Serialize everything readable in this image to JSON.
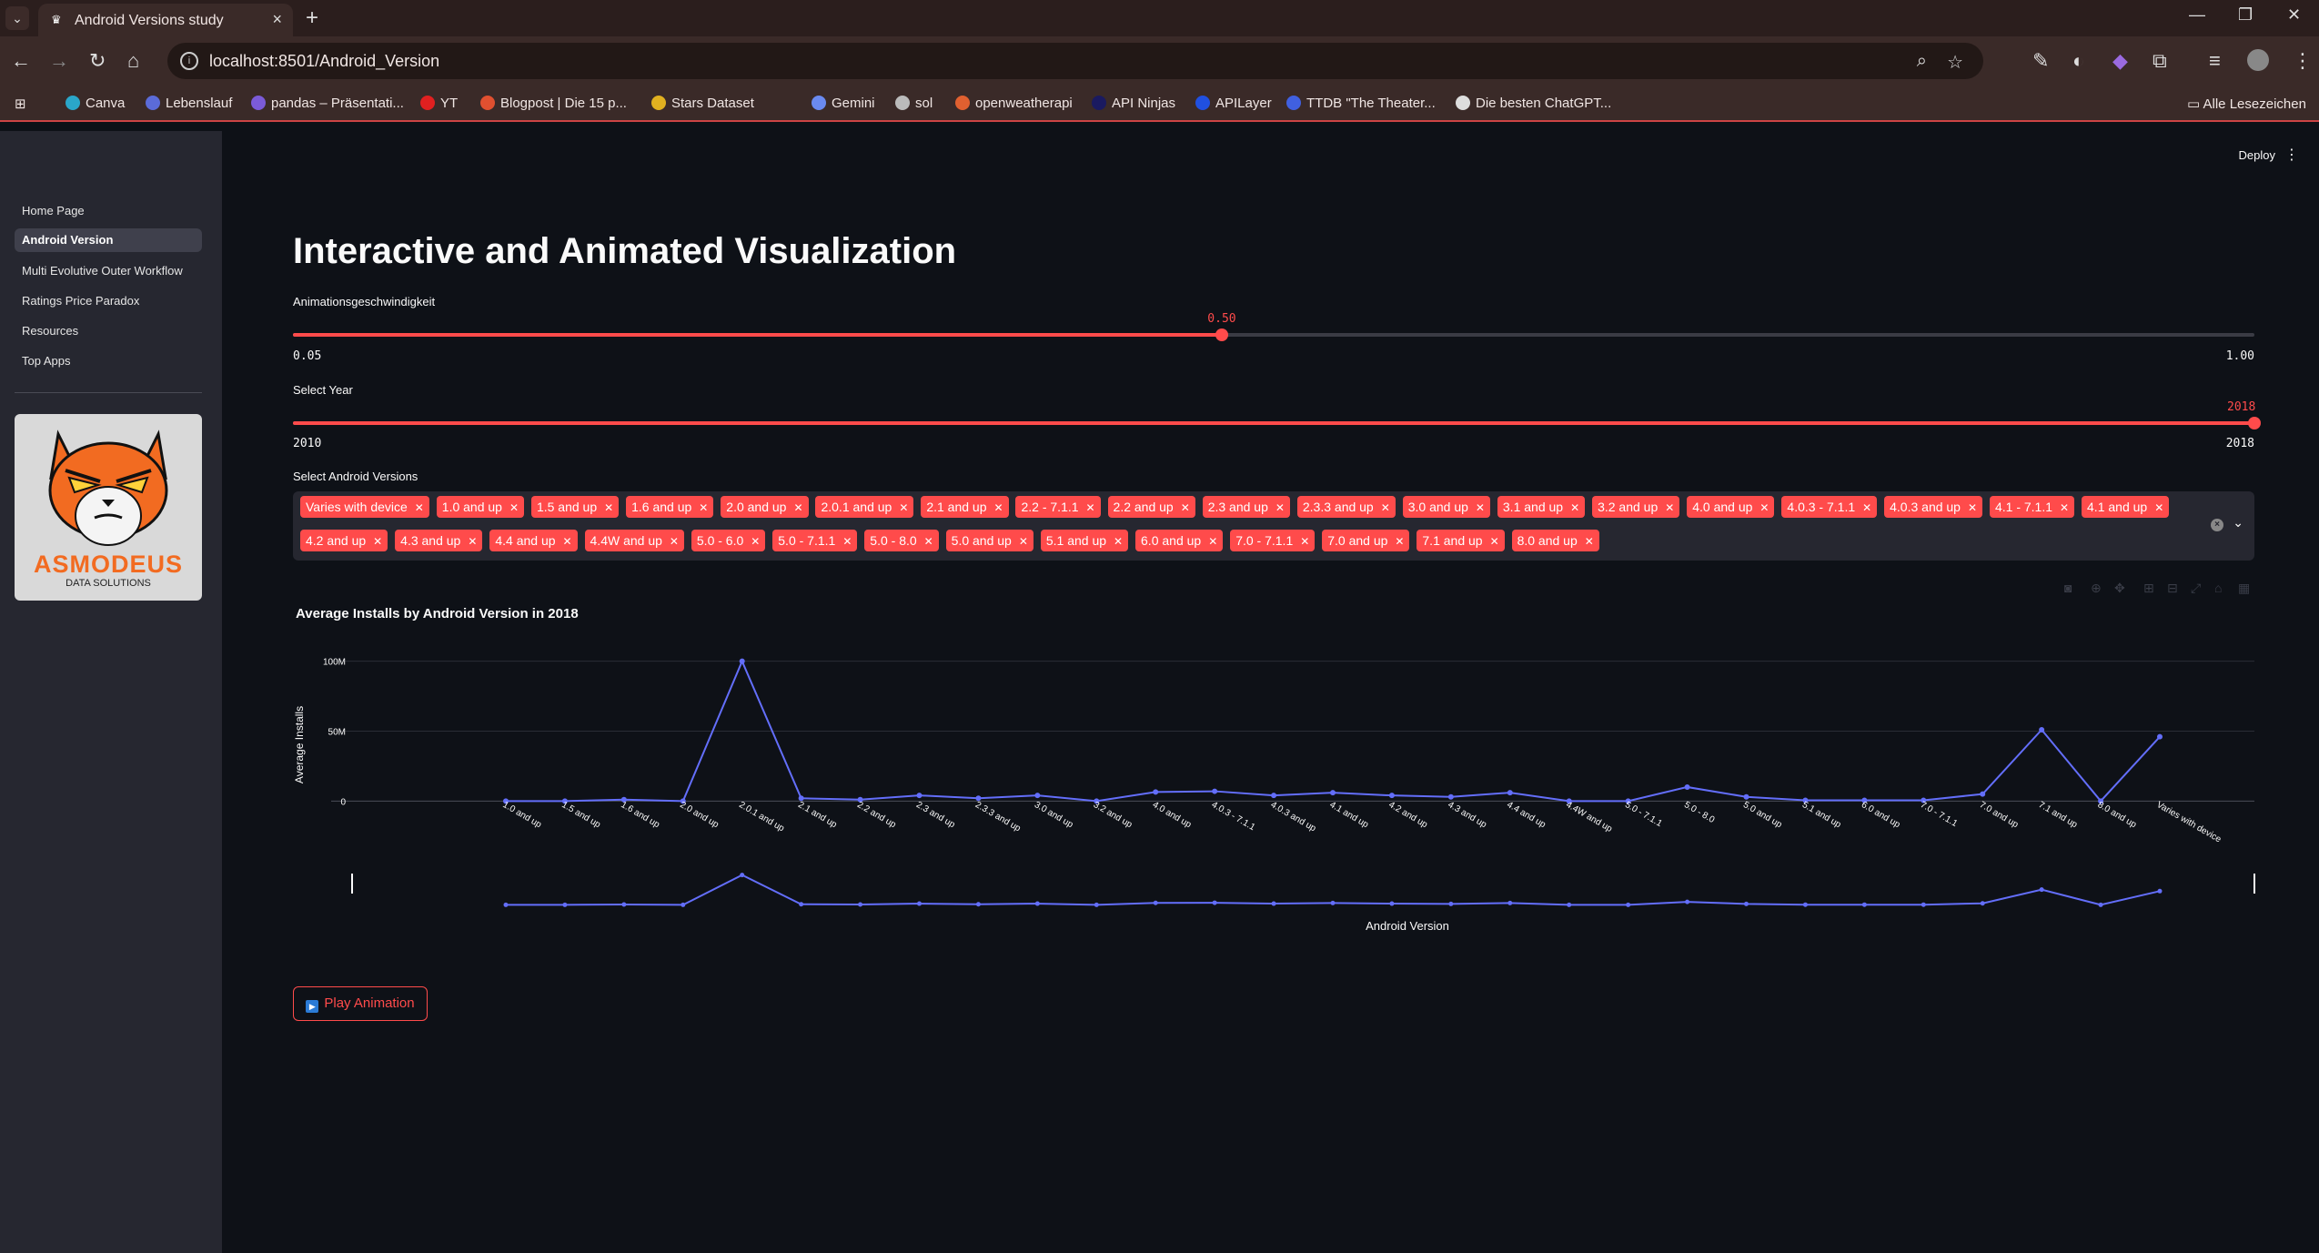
{
  "browser": {
    "tab_title": "Android Versions study",
    "new_tab": "+",
    "url": "localhost:8501/Android_Version",
    "bookmarks": [
      {
        "label": "Canva",
        "color": "#2aa6c9"
      },
      {
        "label": "Lebenslauf",
        "color": "#5b6bd8"
      },
      {
        "label": "pandas – Präsentati...",
        "color": "#7b5bd8"
      },
      {
        "label": "YT",
        "color": "#e02020"
      },
      {
        "label": "Blogpost | Die 15 p...",
        "color": "#e05030"
      },
      {
        "label": "Stars Dataset",
        "color": "#e0b020"
      },
      {
        "label": "Gemini",
        "color": "#6a8af0"
      },
      {
        "label": "sol",
        "color": "#bbbbbb"
      },
      {
        "label": "openweatherapi",
        "color": "#e06030"
      },
      {
        "label": "API Ninjas",
        "color": "#1a1a60"
      },
      {
        "label": "APILayer",
        "color": "#2050e0"
      },
      {
        "label": "TTDB \"The Theater...",
        "color": "#4060e0"
      },
      {
        "label": "Die besten ChatGPT...",
        "color": "#dddddd"
      }
    ],
    "bookmarks_right": "Alle Lesezeichen"
  },
  "sidebar": {
    "items": [
      {
        "label": "Home Page",
        "active": false
      },
      {
        "label": "Android Version",
        "active": true
      },
      {
        "label": "Multi Evolutive Outer Workflow",
        "active": false
      },
      {
        "label": "Ratings Price Paradox",
        "active": false
      },
      {
        "label": "Resources",
        "active": false
      },
      {
        "label": "Top Apps",
        "active": false
      }
    ],
    "logo": {
      "brand": "ASMODEUS",
      "tagline": "DATA SOLUTIONS"
    }
  },
  "header": {
    "deploy": "Deploy"
  },
  "page": {
    "title": "Interactive and Animated Visualization",
    "speed_slider": {
      "label": "Animationsgeschwindigkeit",
      "value": "0.50",
      "min": "0.05",
      "max": "1.00",
      "fraction": 0.4737
    },
    "year_slider": {
      "label": "Select Year",
      "value": "2018",
      "min": "2010",
      "max": "2018",
      "fraction": 1.0
    },
    "versions": {
      "label": "Select Android Versions",
      "selected": [
        "Varies with device",
        "1.0 and up",
        "1.5 and up",
        "1.6 and up",
        "2.0 and up",
        "2.0.1 and up",
        "2.1 and up",
        "2.2 - 7.1.1",
        "2.2 and up",
        "2.3 and up",
        "2.3.3 and up",
        "3.0 and up",
        "3.1 and up",
        "3.2 and up",
        "4.0 and up",
        "4.0.3 - 7.1.1",
        "4.0.3 and up",
        "4.1 - 7.1.1",
        "4.1 and up",
        "4.2 and up",
        "4.3 and up",
        "4.4 and up",
        "4.4W and up",
        "5.0 - 6.0",
        "5.0 - 7.1.1",
        "5.0 - 8.0",
        "5.0 and up",
        "5.1 and up",
        "6.0 and up",
        "7.0 - 7.1.1",
        "7.0 and up",
        "7.1 and up",
        "8.0 and up"
      ]
    },
    "play_button": "Play Animation"
  },
  "chart_data": {
    "type": "line",
    "title": "Average Installs by Android Version in 2018",
    "xlabel": "Android Version",
    "ylabel": "Average Installs",
    "ylim": [
      -5000000,
      105000000
    ],
    "yticks": [
      {
        "value": 0,
        "label": "0"
      },
      {
        "value": 50000000,
        "label": "50M"
      },
      {
        "value": 100000000,
        "label": "100M"
      }
    ],
    "grid": true,
    "color": "#636efa",
    "rangeslider": true,
    "categories": [
      "1.0 and up",
      "1.5 and up",
      "1.6 and up",
      "2.0 and up",
      "2.0.1 and up",
      "2.1 and up",
      "2.2 and up",
      "2.3 and up",
      "2.3.3 and up",
      "3.0 and up",
      "3.2 and up",
      "4.0 and up",
      "4.0.3 - 7.1.1",
      "4.0.3 and up",
      "4.1 and up",
      "4.2 and up",
      "4.3 and up",
      "4.4 and up",
      "4.4W and up",
      "5.0 - 7.1.1",
      "5.0 - 8.0",
      "5.0 and up",
      "5.1 and up",
      "6.0 and up",
      "7.0 - 7.1.1",
      "7.0 and up",
      "7.1 and up",
      "8.0 and up",
      "Varies with device"
    ],
    "values": [
      0,
      0,
      1000000,
      0,
      100000000,
      2000000,
      1000000,
      4000000,
      2000000,
      4000000,
      0,
      6500000,
      7000000,
      4000000,
      6000000,
      4000000,
      3000000,
      6000000,
      0,
      0,
      10000000,
      3000000,
      500000,
      500000,
      500000,
      5000000,
      51000000,
      0,
      46000000
    ]
  }
}
